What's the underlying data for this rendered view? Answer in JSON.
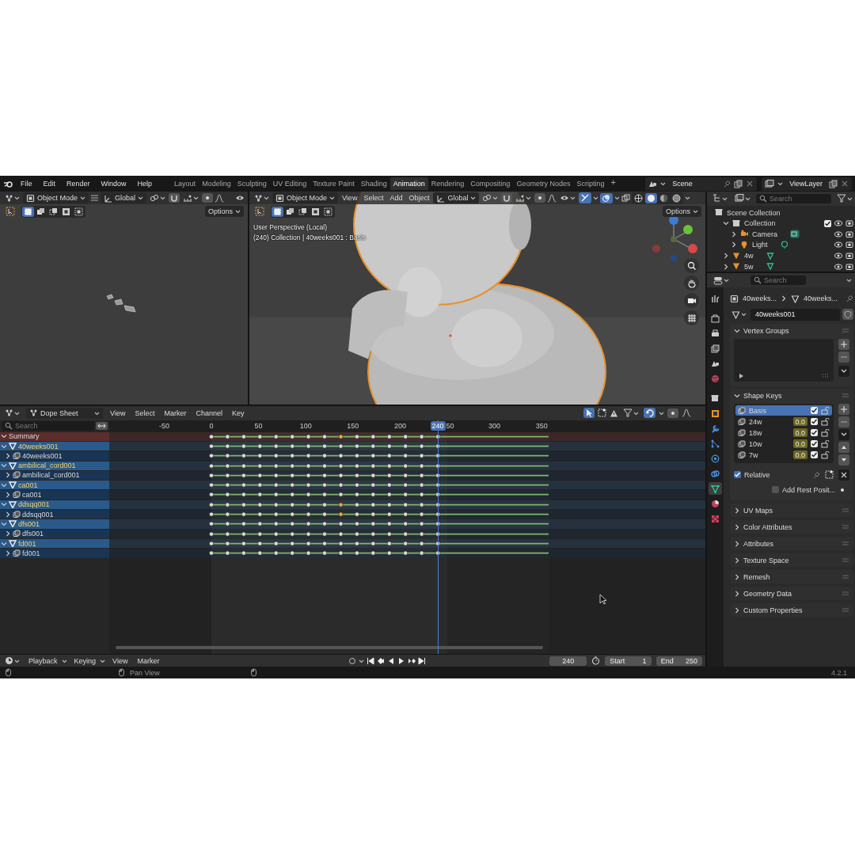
{
  "menu": [
    "File",
    "Edit",
    "Render",
    "Window",
    "Help"
  ],
  "workspaces": [
    {
      "label": "Layout",
      "selected": false
    },
    {
      "label": "Modeling",
      "selected": false
    },
    {
      "label": "Sculpting",
      "selected": false
    },
    {
      "label": "UV Editing",
      "selected": false
    },
    {
      "label": "Texture Paint",
      "selected": false
    },
    {
      "label": "Shading",
      "selected": false
    },
    {
      "label": "Animation",
      "selected": true
    },
    {
      "label": "Rendering",
      "selected": false
    },
    {
      "label": "Compositing",
      "selected": false
    },
    {
      "label": "Geometry Nodes",
      "selected": false
    },
    {
      "label": "Scripting",
      "selected": false
    }
  ],
  "add_workspace": "+",
  "scene": "Scene",
  "view_layer": "ViewLayer",
  "viewport_left": {
    "mode": "Object Mode",
    "orientation": "Global",
    "options": "Options"
  },
  "viewport_right": {
    "mode": "Object Mode",
    "menus": [
      "View",
      "Select",
      "Add",
      "Object"
    ],
    "orientation": "Global",
    "options": "Options",
    "shading": [
      {
        "kind": "wireframe",
        "selected": false
      },
      {
        "kind": "solid",
        "selected": true
      },
      {
        "kind": "material",
        "selected": false
      },
      {
        "kind": "rendered",
        "selected": false
      }
    ],
    "info": [
      "User Perspective (Local)",
      "(240) Collection | 40weeks001 : Basis"
    ],
    "view": {
      "kind": "picture"
    }
  },
  "dope_sheet": {
    "editor": "Dope Sheet",
    "menus": [
      "View",
      "Select",
      "Marker",
      "Channel",
      "Key"
    ],
    "search": {
      "placeholder": "Search"
    },
    "frame_ticks": [
      "-50",
      "0",
      "50",
      "100",
      "150",
      "200",
      "50",
      "300",
      "350"
    ],
    "current_frame": "240",
    "channels": [
      {
        "name": "Summary",
        "kind": "summary",
        "expanded": true,
        "keys": [
          false,
          false,
          false,
          false,
          false,
          false,
          false,
          false,
          true,
          false,
          false,
          false,
          false,
          false,
          false
        ],
        "children": [
          {
            "name": "40weeks001",
            "kind": "object",
            "expanded": true,
            "keys": [
              false,
              false,
              false,
              false,
              false,
              false,
              false,
              false,
              false,
              false,
              false,
              false,
              false,
              false,
              false
            ],
            "children": [
              {
                "name": "40weeks001",
                "kind": "shape_keys",
                "expanded": false,
                "keys": [
                  false,
                  false,
                  false,
                  false,
                  false,
                  false,
                  false,
                  false,
                  false,
                  false,
                  false,
                  false,
                  false,
                  false,
                  false
                ]
              }
            ]
          },
          {
            "name": "ambilical_cord001",
            "kind": "object",
            "expanded": true,
            "keys": [
              false,
              false,
              false,
              false,
              false,
              false,
              false,
              false,
              false,
              false,
              false,
              false,
              false,
              false,
              false
            ],
            "children": [
              {
                "name": "ambilical_cord001",
                "kind": "shape_keys",
                "expanded": false,
                "keys": [
                  false,
                  false,
                  false,
                  false,
                  false,
                  false,
                  false,
                  false,
                  false,
                  false,
                  false,
                  false,
                  false,
                  false,
                  false
                ]
              }
            ]
          },
          {
            "name": "ca001",
            "kind": "object",
            "expanded": true,
            "keys": [
              false,
              false,
              false,
              false,
              false,
              false,
              false,
              false,
              false,
              false,
              false,
              false,
              false,
              false,
              false
            ],
            "children": [
              {
                "name": "ca001",
                "kind": "shape_keys",
                "expanded": false,
                "keys": [
                  false,
                  false,
                  false,
                  false,
                  false,
                  false,
                  false,
                  false,
                  false,
                  false,
                  false,
                  false,
                  false,
                  false,
                  false
                ]
              }
            ]
          },
          {
            "name": "ddsqq001",
            "kind": "object",
            "expanded": true,
            "keys": [
              false,
              false,
              false,
              false,
              false,
              false,
              false,
              false,
              true,
              false,
              false,
              false,
              false,
              false,
              false
            ],
            "children": [
              {
                "name": "ddsqq001",
                "kind": "shape_keys",
                "expanded": false,
                "keys": [
                  false,
                  false,
                  false,
                  false,
                  false,
                  false,
                  false,
                  false,
                  true,
                  false,
                  false,
                  false,
                  false,
                  false,
                  false
                ]
              }
            ]
          },
          {
            "name": "dfs001",
            "kind": "object",
            "expanded": true,
            "keys": [
              false,
              false,
              false,
              false,
              false,
              false,
              false,
              false,
              false,
              false,
              false,
              false,
              false,
              false,
              false
            ],
            "children": [
              {
                "name": "dfs001",
                "kind": "shape_keys",
                "expanded": false,
                "keys": [
                  false,
                  false,
                  false,
                  false,
                  false,
                  false,
                  false,
                  false,
                  false,
                  false,
                  false,
                  false,
                  false,
                  false,
                  false
                ]
              }
            ]
          },
          {
            "name": "fd001",
            "kind": "object",
            "expanded": true,
            "keys": [
              false,
              false,
              false,
              false,
              false,
              false,
              false,
              false,
              false,
              false,
              false,
              false,
              false,
              false,
              false
            ],
            "children": [
              {
                "name": "fd001",
                "kind": "shape_keys",
                "expanded": false,
                "keys": [
                  false,
                  false,
                  false,
                  false,
                  false,
                  false,
                  false,
                  false,
                  false,
                  false,
                  false,
                  false,
                  false,
                  false,
                  false
                ]
              }
            ]
          }
        ]
      }
    ]
  },
  "timeline": {
    "menus": [
      {
        "label": "Playback",
        "dropdown": true
      },
      {
        "label": "Keying",
        "dropdown": true
      },
      {
        "label": "View",
        "dropdown": false
      },
      {
        "label": "Marker",
        "dropdown": false
      }
    ],
    "frame": "240",
    "start_label": "Start",
    "start": "1",
    "end_label": "End",
    "end": "250"
  },
  "outliner": {
    "search": {
      "placeholder": "Search"
    },
    "items": [
      {
        "name": "Scene Collection",
        "kind": "scene_collection",
        "children": [
          {
            "name": "Collection",
            "kind": "collection",
            "expanded": true,
            "checked": true,
            "children": [
              {
                "name": "Camera",
                "kind": "camera",
                "expanded": false
              },
              {
                "name": "Light",
                "kind": "light",
                "expanded": false
              }
            ]
          },
          {
            "name": "4w",
            "kind": "mesh",
            "expanded": false
          },
          {
            "name": "5w",
            "kind": "mesh",
            "expanded": false
          }
        ]
      }
    ]
  },
  "properties": {
    "search": {
      "placeholder": "Search"
    },
    "tabs": [
      {
        "kind": "tool",
        "selected": false
      },
      {
        "kind": "render",
        "selected": false
      },
      {
        "kind": "output",
        "selected": false
      },
      {
        "kind": "view_layer",
        "selected": false
      },
      {
        "kind": "scene",
        "selected": false
      },
      {
        "kind": "world",
        "selected": false
      },
      {
        "kind": "collection",
        "selected": false
      },
      {
        "kind": "object",
        "selected": false
      },
      {
        "kind": "modifiers",
        "selected": false
      },
      {
        "kind": "particles",
        "selected": false
      },
      {
        "kind": "physics",
        "selected": false
      },
      {
        "kind": "constraints",
        "selected": false
      },
      {
        "kind": "data",
        "selected": true
      },
      {
        "kind": "material",
        "selected": false
      },
      {
        "kind": "texture",
        "selected": false
      }
    ],
    "breadcrumb": [
      "40weeks...",
      "40weeks..."
    ],
    "data_name": "40weeks001",
    "panels": [
      {
        "title": "Vertex Groups",
        "kind": "vertex_groups",
        "expanded": true
      },
      {
        "title": "Shape Keys",
        "kind": "shape_keys",
        "expanded": true,
        "keys": [
          {
            "name": "Basis",
            "selected": true,
            "enabled": true
          },
          {
            "name": "24w",
            "value": "0.0",
            "selected": false,
            "enabled": true
          },
          {
            "name": "18w",
            "value": "0.0",
            "selected": false,
            "enabled": true
          },
          {
            "name": "10w",
            "value": "0.0",
            "selected": false,
            "enabled": true
          },
          {
            "name": "7w",
            "value": "0.0",
            "selected": false,
            "enabled": true
          }
        ],
        "relative": {
          "label": "Relative",
          "checked": true
        },
        "rest_position": {
          "label": "Add Rest Posit...",
          "checked": false
        }
      },
      {
        "title": "UV Maps",
        "kind": "generic",
        "expanded": false
      },
      {
        "title": "Color Attributes",
        "kind": "generic",
        "expanded": false
      },
      {
        "title": "Attributes",
        "kind": "generic",
        "expanded": false
      },
      {
        "title": "Texture Space",
        "kind": "generic",
        "expanded": false
      },
      {
        "title": "Remesh",
        "kind": "generic",
        "expanded": false
      },
      {
        "title": "Geometry Data",
        "kind": "generic",
        "expanded": false
      },
      {
        "title": "Custom Properties",
        "kind": "generic",
        "expanded": false
      }
    ]
  },
  "status_bar": {
    "hint": "Pan View",
    "version": "4.2.1"
  }
}
